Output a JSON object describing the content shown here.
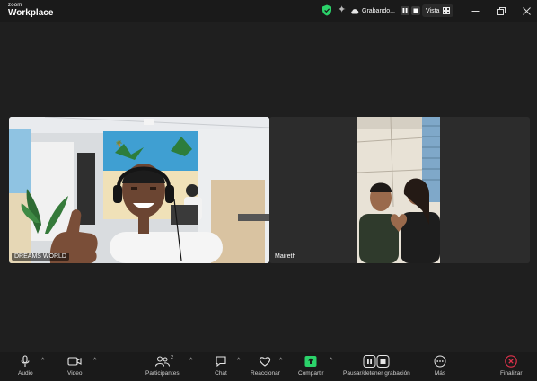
{
  "app": {
    "logo_small": "zoom",
    "logo_large": "Workplace"
  },
  "titlebar": {
    "recording_label": "Grabando...",
    "view_label": "Vista"
  },
  "participants": [
    {
      "name": "DREAMS WORLD"
    },
    {
      "name": "Maireth"
    }
  ],
  "toolbar": {
    "audio": "Audio",
    "video": "Video",
    "participants": "Participantes",
    "participants_count": "2",
    "chat": "Chat",
    "react": "Reaccionar",
    "share": "Compartir",
    "record": "Pausar/detener grabación",
    "more": "Más",
    "end": "Finalizar"
  },
  "colors": {
    "share_accent": "#2bd26a",
    "end_accent": "#e0324c",
    "shield": "#2bd26a"
  }
}
